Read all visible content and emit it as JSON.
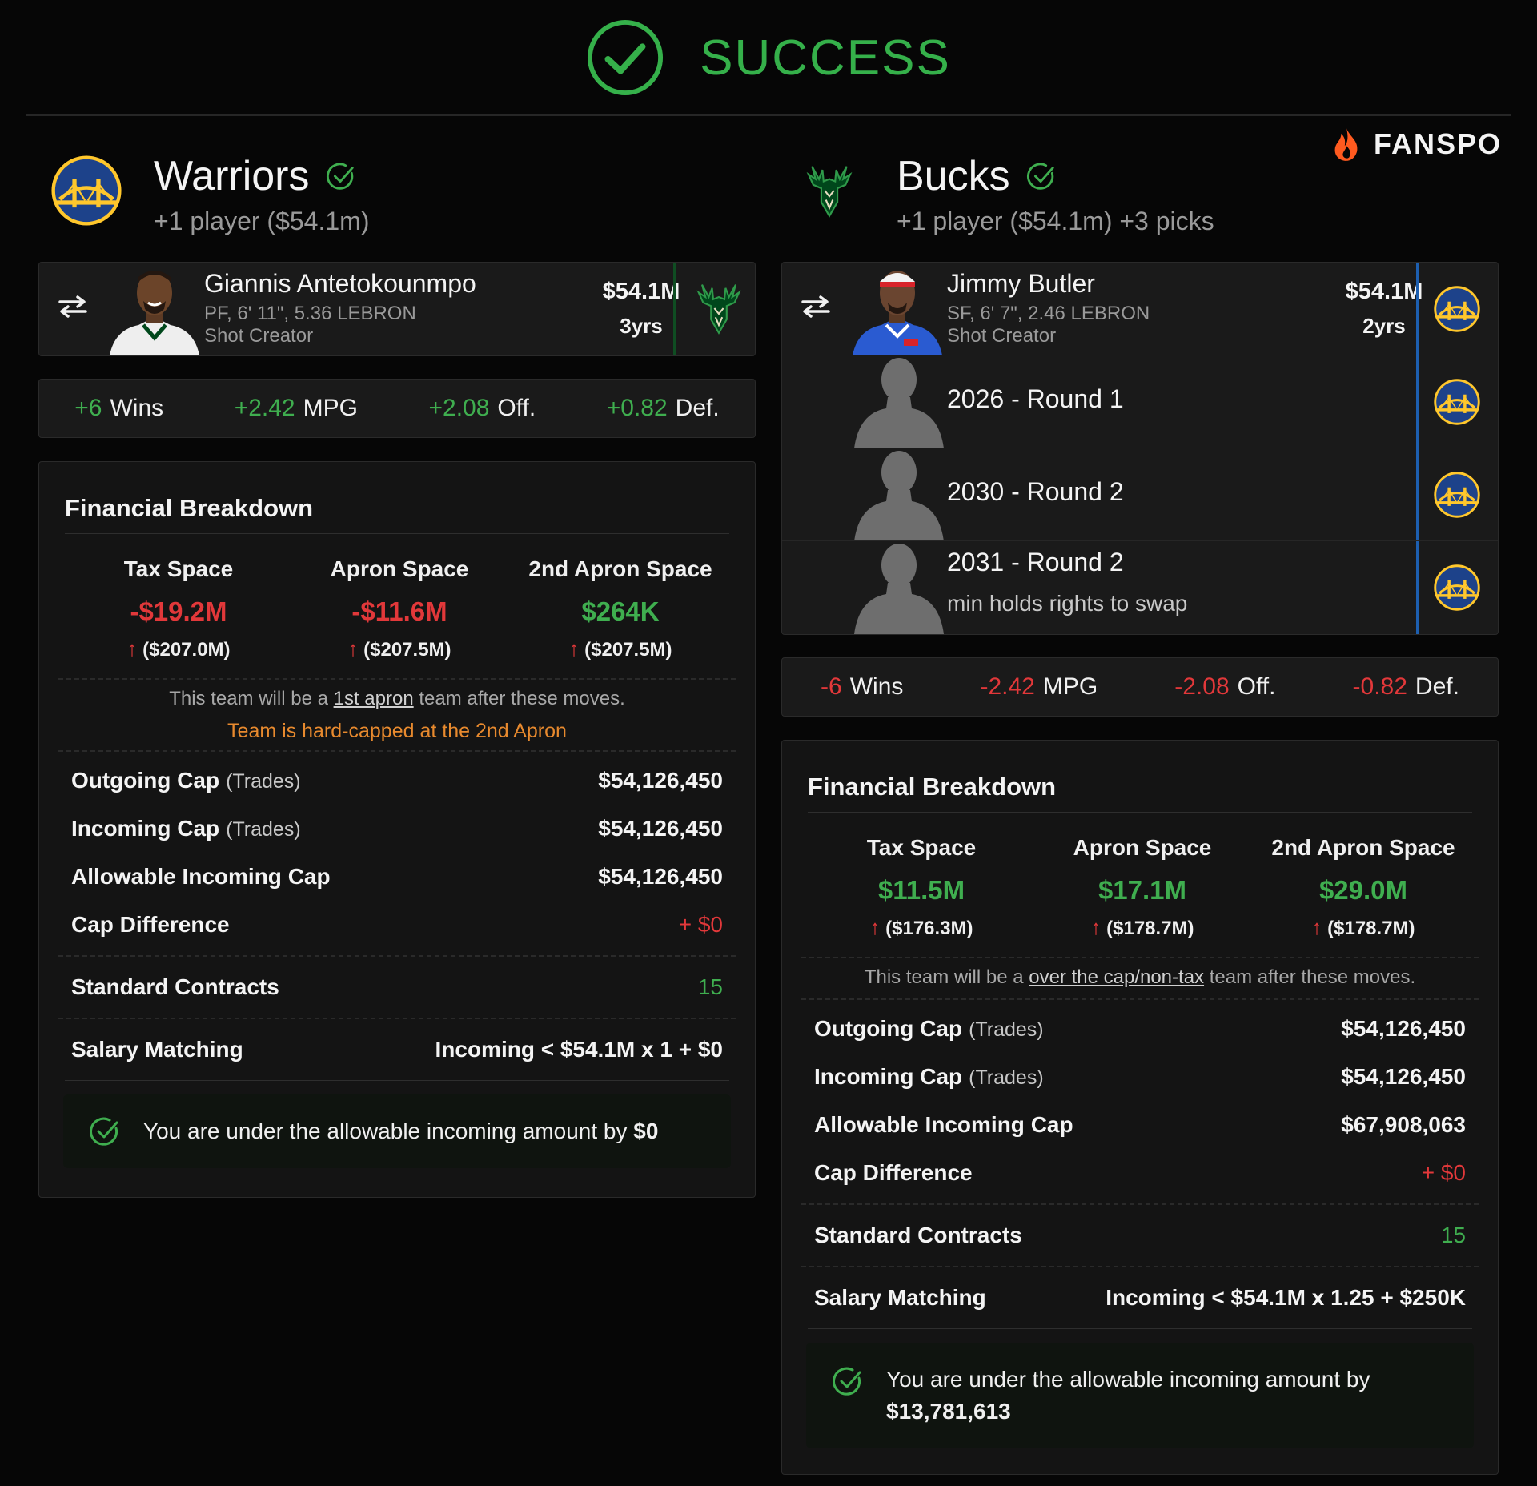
{
  "banner": {
    "title": "SUCCESS",
    "icon": "check-circle-icon"
  },
  "brand": {
    "name": "FANSPO",
    "icon": "flame-icon"
  },
  "colors": {
    "success": "#35b04a",
    "negative": "#e2383a",
    "warning": "#e88a2e",
    "warriors_blue": "#1d428a",
    "warriors_gold": "#ffc72c",
    "bucks_green": "#00471b"
  },
  "teams": [
    {
      "name": "Warriors",
      "summary": "+1 player ($54.1m)",
      "logo": "warriors-logo",
      "players": [
        {
          "name": "Giannis Antetokounmpo",
          "meta": "PF, 6' 11\", 5.36 LEBRON",
          "role": "Shot Creator",
          "salary": "$54.1M",
          "years": "3yrs",
          "from": "bucks-logo"
        }
      ],
      "picks": [],
      "stats": {
        "wins": "+6",
        "wins_label": "Wins",
        "mpg": "+2.42",
        "mpg_label": "MPG",
        "off": "+2.08",
        "off_label": "Off.",
        "def": "+0.82",
        "def_label": "Def."
      },
      "financial": {
        "title": "Financial Breakdown",
        "tax": {
          "label": "Tax Space",
          "value": "-$19.2M",
          "sub": "($207.0M)"
        },
        "apron": {
          "label": "Apron Space",
          "value": "-$11.6M",
          "sub": "($207.5M)"
        },
        "apron2": {
          "label": "2nd Apron Space",
          "value": "$264K",
          "sub": "($207.5M)"
        },
        "note_pre": "This team will be a ",
        "note_link": "1st apron",
        "note_post": " team after these moves.",
        "warning": "Team is hard-capped at the 2nd Apron",
        "outgoing_label": "Outgoing Cap",
        "outgoing_sub": "(Trades)",
        "outgoing": "$54,126,450",
        "incoming_label": "Incoming Cap",
        "incoming_sub": "(Trades)",
        "incoming": "$54,126,450",
        "allowable_label": "Allowable Incoming Cap",
        "allowable": "$54,126,450",
        "diff_label": "Cap Difference",
        "diff": "+ $0",
        "contracts_label": "Standard Contracts",
        "contracts": "15",
        "matching_label": "Salary Matching",
        "matching": "Incoming < $54.1M x 1 + $0",
        "ok_text": "You are under the allowable incoming amount by ",
        "ok_amount": "$0"
      }
    },
    {
      "name": "Bucks",
      "summary": "+1 player ($54.1m) +3 picks",
      "logo": "bucks-logo",
      "players": [
        {
          "name": "Jimmy Butler",
          "meta": "SF, 6' 7\", 2.46 LEBRON",
          "role": "Shot Creator",
          "salary": "$54.1M",
          "years": "2yrs",
          "from": "warriors-logo"
        }
      ],
      "picks": [
        {
          "label": "2026 - Round 1",
          "note": ""
        },
        {
          "label": "2030 - Round 2",
          "note": ""
        },
        {
          "label": "2031 - Round 2",
          "note": "min holds rights to swap"
        }
      ],
      "stats": {
        "wins": "-6",
        "wins_label": "Wins",
        "mpg": "-2.42",
        "mpg_label": "MPG",
        "off": "-2.08",
        "off_label": "Off.",
        "def": "-0.82",
        "def_label": "Def."
      },
      "financial": {
        "title": "Financial Breakdown",
        "tax": {
          "label": "Tax Space",
          "value": "$11.5M",
          "sub": "($176.3M)"
        },
        "apron": {
          "label": "Apron Space",
          "value": "$17.1M",
          "sub": "($178.7M)"
        },
        "apron2": {
          "label": "2nd Apron Space",
          "value": "$29.0M",
          "sub": "($178.7M)"
        },
        "note_pre": "This team will be a ",
        "note_link": "over the cap/non-tax",
        "note_post": " team after these moves.",
        "outgoing_label": "Outgoing Cap",
        "outgoing_sub": "(Trades)",
        "outgoing": "$54,126,450",
        "incoming_label": "Incoming Cap",
        "incoming_sub": "(Trades)",
        "incoming": "$54,126,450",
        "allowable_label": "Allowable Incoming Cap",
        "allowable": "$67,908,063",
        "diff_label": "Cap Difference",
        "diff": "+ $0",
        "contracts_label": "Standard Contracts",
        "contracts": "15",
        "matching_label": "Salary Matching",
        "matching": "Incoming < $54.1M x 1.25 + $250K",
        "ok_text": "You are under the allowable incoming amount by",
        "ok_amount": "$13,781,613"
      }
    }
  ]
}
